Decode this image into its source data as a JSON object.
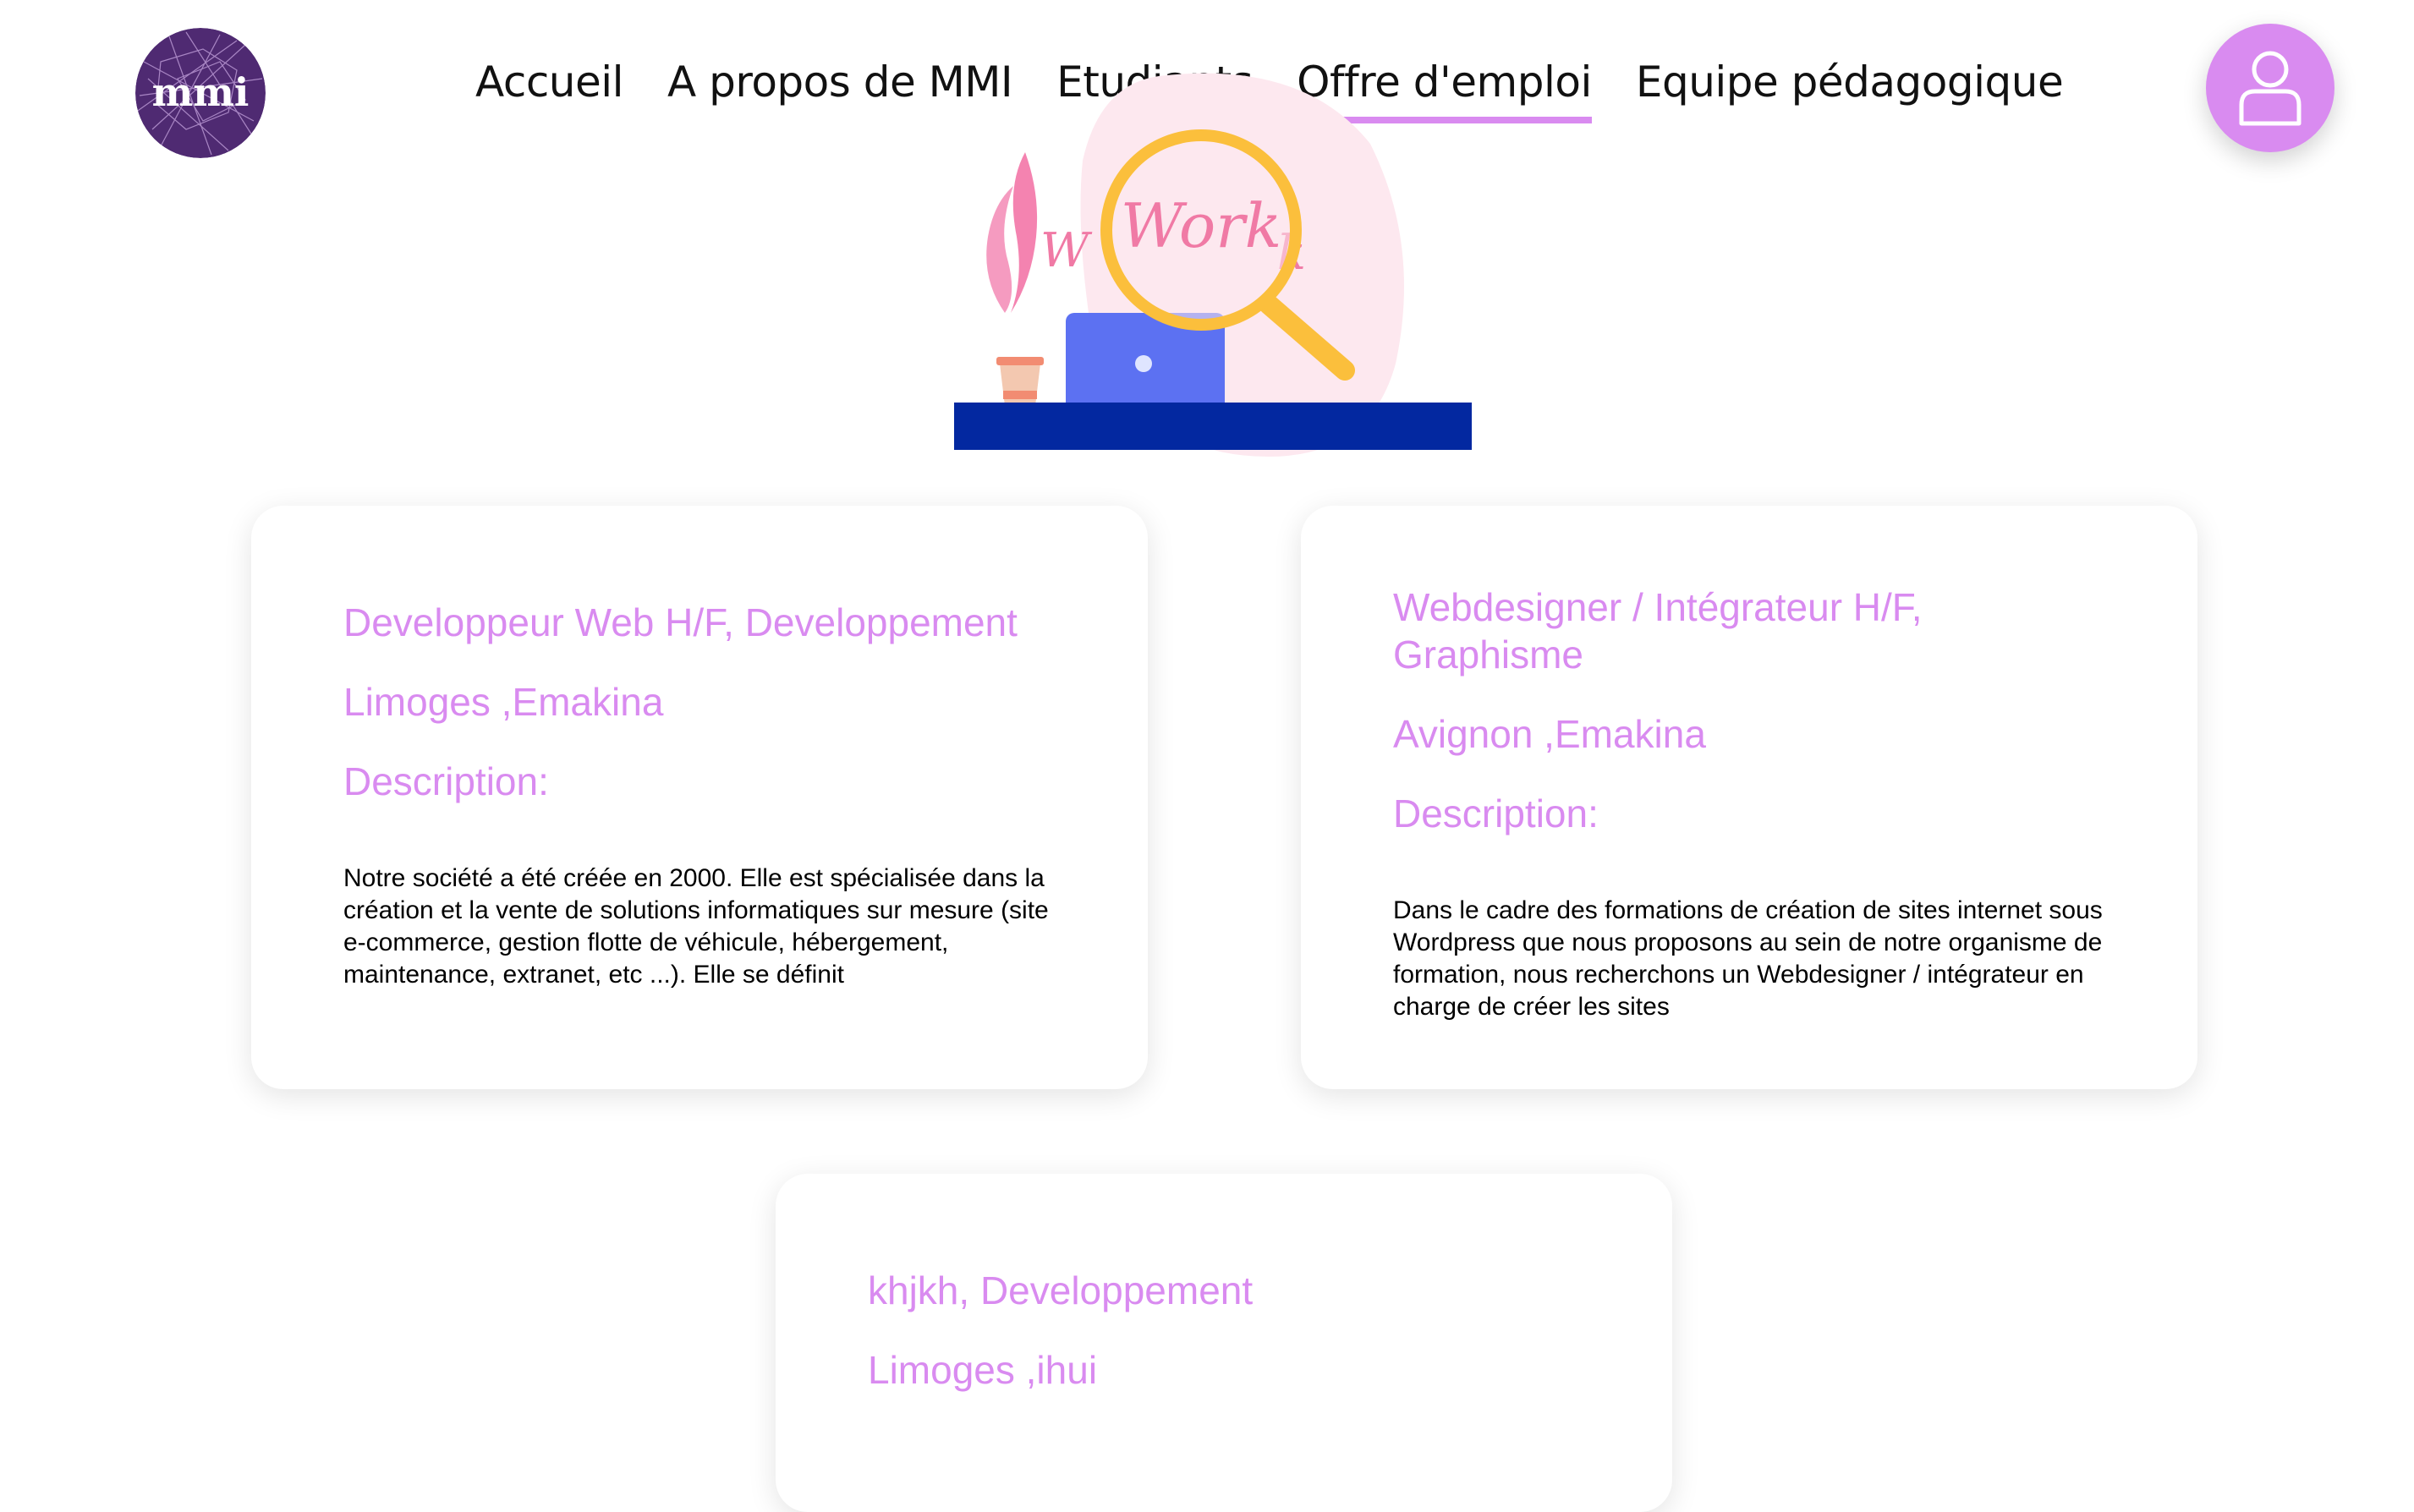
{
  "header": {
    "logo_text": "mmi",
    "nav": [
      {
        "label": "Accueil"
      },
      {
        "label": "A propos de MMI"
      },
      {
        "label": "Etudiants"
      },
      {
        "label": "Offre d'emploi",
        "active": true
      },
      {
        "label": "Equipe pédagogique"
      }
    ],
    "user_icon": "user-icon"
  },
  "hero": {
    "work_text": "Work"
  },
  "offers": [
    {
      "title": "Developpeur Web H/F, Developpement",
      "location": "Limoges ,Emakina",
      "description_label": "Description:",
      "description": "Notre société a été créée en 2000. Elle est spécialisée dans la création et la vente de solutions informatiques sur mesure (site e-commerce, gestion flotte de véhicule, hébergement, maintenance, extranet, etc ...). Elle se définit"
    },
    {
      "title": "Webdesigner / Intégrateur H/F, Graphisme",
      "location": "Avignon ,Emakina",
      "description_label": "Description:",
      "description": "Dans le cadre des formations de création de sites internet sous Wordpress que nous proposons au sein de notre organisme de formation, nous recherchons un Webdesigner / intégrateur en charge de créer les sites"
    },
    {
      "title": "khjkh, Developpement",
      "location": "Limoges ,ihui"
    }
  ],
  "colors": {
    "accent": "#d98bf0",
    "logo_bg": "#4f2a72",
    "desk": "#0328a0",
    "laptop": "#5c71f2",
    "magnifier": "#fbbf3c",
    "blob": "#fde8ef"
  }
}
